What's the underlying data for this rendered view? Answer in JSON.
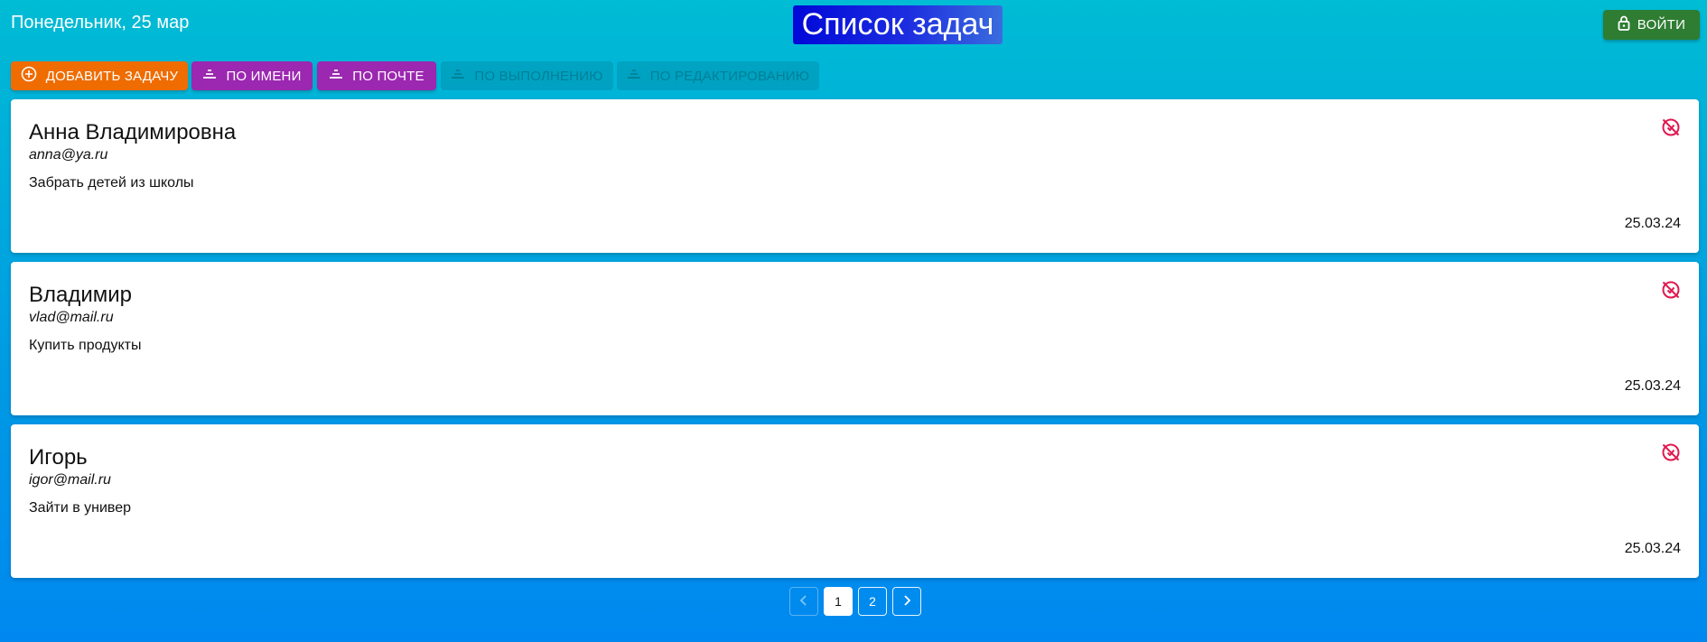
{
  "header": {
    "date": "Понедельник, 25 мар",
    "title": "Список задач",
    "login_label": "ВОЙТИ",
    "login_icon": "lock-icon"
  },
  "toolbar": {
    "add_label": "ДОБАВИТЬ ЗАДАЧУ",
    "sort_name_label": "ПО ИМЕНИ",
    "sort_email_label": "ПО ПОЧТЕ",
    "sort_done_label": "ПО ВЫПОЛНЕНИЮ",
    "sort_edited_label": "ПО РЕДАКТИРОВАНИЮ"
  },
  "tasks": [
    {
      "name": "Анна Владимировна",
      "email": "anna@ya.ru",
      "text": "Забрать детей из школы",
      "date": "25.03.24",
      "status_icon": "not-done-icon"
    },
    {
      "name": "Владимир",
      "email": "vlad@mail.ru",
      "text": "Купить продукты",
      "date": "25.03.24",
      "status_icon": "not-done-icon"
    },
    {
      "name": "Игорь",
      "email": "igor@mail.ru",
      "text": "Зайти в универ",
      "date": "25.03.24",
      "status_icon": "not-done-icon"
    }
  ],
  "pagination": {
    "pages": [
      "1",
      "2"
    ],
    "current": "1"
  },
  "colors": {
    "add_button": "#ef6c00",
    "sort_button": "#9c27b0",
    "login_button": "#2e7d32",
    "status_icon": "#e0194f"
  }
}
